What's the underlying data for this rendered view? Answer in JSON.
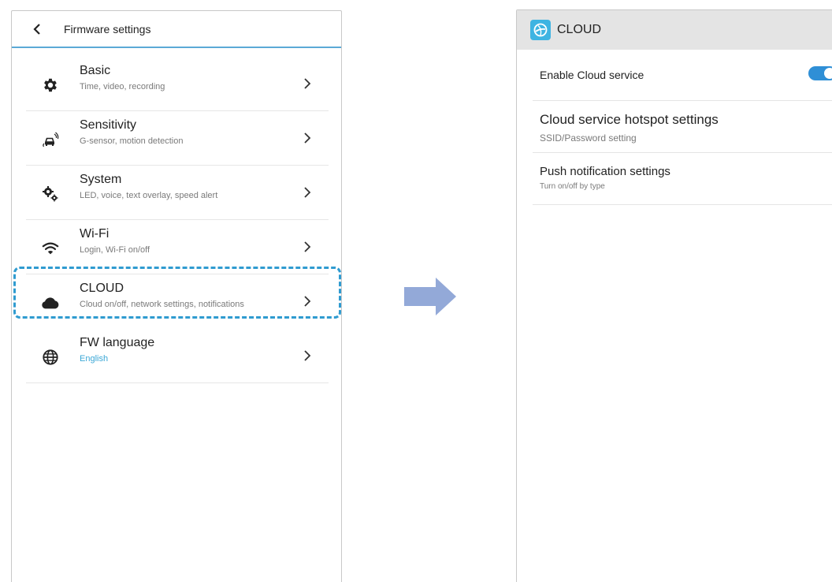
{
  "left_screen": {
    "header": {
      "title": "Firmware settings",
      "back_icon": "chevron-left-icon"
    },
    "items": [
      {
        "title": "Basic",
        "subtitle": "Time, video, recording",
        "icon": "gear-icon"
      },
      {
        "title": "Sensitivity",
        "subtitle": "G-sensor, motion detection",
        "icon": "car-sensor-icon"
      },
      {
        "title": "System",
        "subtitle": "LED, voice, text overlay, speed alert",
        "icon": "gears-icon"
      },
      {
        "title": "Wi-Fi",
        "subtitle": "Login, Wi-Fi on/off",
        "icon": "wifi-icon"
      },
      {
        "title": "CLOUD",
        "subtitle": "Cloud on/off, network settings, notifications",
        "icon": "cloud-icon"
      },
      {
        "title": "FW language",
        "subtitle": "English",
        "icon": "globe-icon"
      }
    ],
    "highlighted_item": "CLOUD"
  },
  "right_screen": {
    "header": {
      "title": "CLOUD",
      "logo_icon": "app-logo-icon"
    },
    "items": [
      {
        "title": "Enable Cloud service",
        "toggle_on": true
      },
      {
        "title": "Cloud service hotspot settings",
        "subtitle": "SSID/Password setting"
      },
      {
        "title": "Push notification settings",
        "subtitle": "Turn on/off by type"
      }
    ]
  },
  "colors": {
    "accent": "#2f9bd0",
    "arrow": "#93a9d8",
    "toggle": "#2f8fd6",
    "header_bg": "#e4e4e4"
  }
}
